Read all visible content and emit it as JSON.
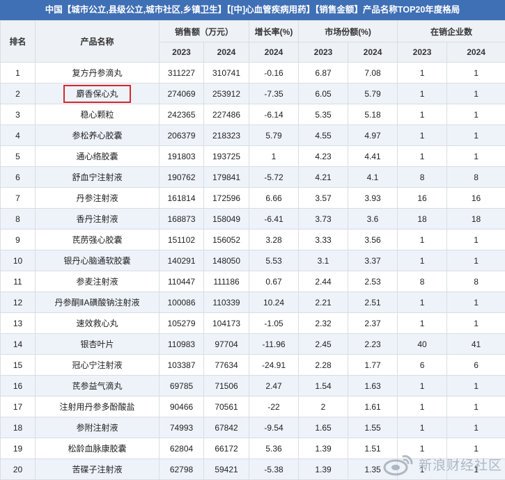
{
  "title": "中国【城市公立,县级公立,城市社区,乡镇卫生】【[中]心血管疾病用药】【销售金额】产品名称TOP20年度格局",
  "headers": {
    "rank": "排名",
    "name": "产品名称",
    "sales": "销售额（万元）",
    "growth": "增长率(%)",
    "share": "市场份额(%)",
    "companies": "在销企业数",
    "y2023": "2023",
    "y2024": "2024"
  },
  "rows": [
    {
      "rank": "1",
      "name": "复方丹参滴丸",
      "s23": "311227",
      "s24": "310741",
      "g": "-0.16",
      "m23": "6.87",
      "m24": "7.08",
      "c23": "1",
      "c24": "1"
    },
    {
      "rank": "2",
      "name": "麝香保心丸",
      "s23": "274069",
      "s24": "253912",
      "g": "-7.35",
      "m23": "6.05",
      "m24": "5.79",
      "c23": "1",
      "c24": "1"
    },
    {
      "rank": "3",
      "name": "稳心颗粒",
      "s23": "242365",
      "s24": "227486",
      "g": "-6.14",
      "m23": "5.35",
      "m24": "5.18",
      "c23": "1",
      "c24": "1"
    },
    {
      "rank": "4",
      "name": "参松养心胶囊",
      "s23": "206379",
      "s24": "218323",
      "g": "5.79",
      "m23": "4.55",
      "m24": "4.97",
      "c23": "1",
      "c24": "1"
    },
    {
      "rank": "5",
      "name": "通心络胶囊",
      "s23": "191803",
      "s24": "193725",
      "g": "1",
      "m23": "4.23",
      "m24": "4.41",
      "c23": "1",
      "c24": "1"
    },
    {
      "rank": "6",
      "name": "舒血宁注射液",
      "s23": "190762",
      "s24": "179841",
      "g": "-5.72",
      "m23": "4.21",
      "m24": "4.1",
      "c23": "8",
      "c24": "8"
    },
    {
      "rank": "7",
      "name": "丹参注射液",
      "s23": "161814",
      "s24": "172596",
      "g": "6.66",
      "m23": "3.57",
      "m24": "3.93",
      "c23": "16",
      "c24": "16"
    },
    {
      "rank": "8",
      "name": "香丹注射液",
      "s23": "168873",
      "s24": "158049",
      "g": "-6.41",
      "m23": "3.73",
      "m24": "3.6",
      "c23": "18",
      "c24": "18"
    },
    {
      "rank": "9",
      "name": "芪苈强心胶囊",
      "s23": "151102",
      "s24": "156052",
      "g": "3.28",
      "m23": "3.33",
      "m24": "3.56",
      "c23": "1",
      "c24": "1"
    },
    {
      "rank": "10",
      "name": "银丹心脑通软胶囊",
      "s23": "140291",
      "s24": "148050",
      "g": "5.53",
      "m23": "3.1",
      "m24": "3.37",
      "c23": "1",
      "c24": "1"
    },
    {
      "rank": "11",
      "name": "参麦注射液",
      "s23": "110447",
      "s24": "111186",
      "g": "0.67",
      "m23": "2.44",
      "m24": "2.53",
      "c23": "8",
      "c24": "8"
    },
    {
      "rank": "12",
      "name": "丹参酮ⅡA磺酸钠注射液",
      "s23": "100086",
      "s24": "110339",
      "g": "10.24",
      "m23": "2.21",
      "m24": "2.51",
      "c23": "1",
      "c24": "1"
    },
    {
      "rank": "13",
      "name": "速效救心丸",
      "s23": "105279",
      "s24": "104173",
      "g": "-1.05",
      "m23": "2.32",
      "m24": "2.37",
      "c23": "1",
      "c24": "1"
    },
    {
      "rank": "14",
      "name": "银杏叶片",
      "s23": "110983",
      "s24": "97704",
      "g": "-11.96",
      "m23": "2.45",
      "m24": "2.23",
      "c23": "40",
      "c24": "41"
    },
    {
      "rank": "15",
      "name": "冠心宁注射液",
      "s23": "103387",
      "s24": "77634",
      "g": "-24.91",
      "m23": "2.28",
      "m24": "1.77",
      "c23": "6",
      "c24": "6"
    },
    {
      "rank": "16",
      "name": "芪参益气滴丸",
      "s23": "69785",
      "s24": "71506",
      "g": "2.47",
      "m23": "1.54",
      "m24": "1.63",
      "c23": "1",
      "c24": "1"
    },
    {
      "rank": "17",
      "name": "注射用丹参多酚酸盐",
      "s23": "90466",
      "s24": "70561",
      "g": "-22",
      "m23": "2",
      "m24": "1.61",
      "c23": "1",
      "c24": "1"
    },
    {
      "rank": "18",
      "name": "参附注射液",
      "s23": "74993",
      "s24": "67842",
      "g": "-9.54",
      "m23": "1.65",
      "m24": "1.55",
      "c23": "1",
      "c24": "1"
    },
    {
      "rank": "19",
      "name": "松龄血脉康胶囊",
      "s23": "62804",
      "s24": "66172",
      "g": "5.36",
      "m23": "1.39",
      "m24": "1.51",
      "c23": "1",
      "c24": "1"
    },
    {
      "rank": "20",
      "name": "苦碟子注射液",
      "s23": "62798",
      "s24": "59421",
      "g": "-5.38",
      "m23": "1.39",
      "m24": "1.35",
      "c23": "1",
      "c24": "1"
    }
  ],
  "highlight_row": 2,
  "highlight_color": "#d8262a",
  "header_color": "#3f6fb5",
  "watermark": {
    "logo_text": "sina",
    "text": "新浪财经社区"
  }
}
